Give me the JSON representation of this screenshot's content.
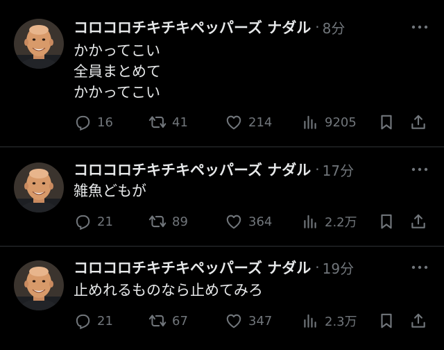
{
  "tweets": [
    {
      "author": "コロコロチキチキペッパーズ ナダル",
      "separator": "·",
      "time": "8分",
      "text_lines": [
        "かかってこい",
        "全員まとめて",
        "かかってこい"
      ],
      "replies": "16",
      "retweets": "41",
      "likes": "214",
      "views": "9205"
    },
    {
      "author": "コロコロチキチキペッパーズ ナダル",
      "separator": "·",
      "time": "17分",
      "text_lines": [
        "雑魚どもが"
      ],
      "replies": "21",
      "retweets": "89",
      "likes": "364",
      "views": "2.2万"
    },
    {
      "author": "コロコロチキチキペッパーズ ナダル",
      "separator": "·",
      "time": "19分",
      "text_lines": [
        "止めれるものなら止めてみろ"
      ],
      "replies": "21",
      "retweets": "67",
      "likes": "347",
      "views": "2.3万"
    }
  ],
  "icons": {
    "reply": "reply-icon",
    "retweet": "retweet-icon",
    "like": "heart-icon",
    "views": "views-chart-icon",
    "bookmark": "bookmark-icon",
    "share": "share-icon",
    "more": "more-dots-icon"
  },
  "colors": {
    "background": "#000000",
    "primary_text": "#e7e9ea",
    "secondary_text": "#71767b",
    "divider": "#2f3336"
  }
}
